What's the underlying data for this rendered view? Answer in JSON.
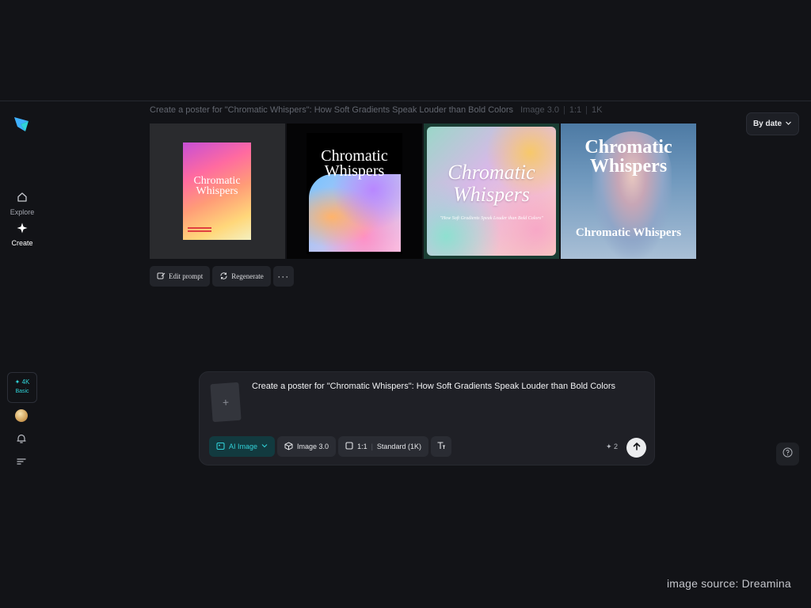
{
  "colors": {
    "background": "#121317",
    "accent": "#31d0d7",
    "surface": "#1f2026"
  },
  "sidebar": {
    "logo_icon": "dreamina-logo-icon",
    "items": [
      {
        "label": "Explore",
        "icon": "home-icon"
      },
      {
        "label": "Create",
        "icon": "sparkle-icon",
        "active": true
      }
    ],
    "credits": {
      "amount": "✦ 4K",
      "tier": "Basic"
    },
    "bottom_icons": [
      "avatar",
      "bell-icon",
      "menu-icon"
    ]
  },
  "generation": {
    "prompt": "Create a poster for \"Chromatic Whispers\": How Soft Gradients Speak Louder than Bold Colors",
    "model": "Image 3.0",
    "ratio": "1:1",
    "resolution": "1K",
    "images": [
      {
        "title_line1": "Chromatic",
        "title_line2": "Whispers"
      },
      {
        "title_line1": "Chromatic",
        "title_line2": "Whispers"
      },
      {
        "title_line1": "Chromatic",
        "title_line2": "Whispers",
        "subtitle": "\"How Soft Gradients Speak Louder than Bold Colors\""
      },
      {
        "title_line1": "Chromatic",
        "title_line2": "Whispers",
        "bottom_title": "Chromatic Whispers"
      }
    ],
    "actions": {
      "edit": "Edit prompt",
      "regenerate": "Regenerate",
      "more": "···"
    }
  },
  "sort": {
    "label": "By date"
  },
  "composer": {
    "prompt": "Create a poster for \"Chromatic Whispers\": How Soft Gradients Speak Louder than Bold Colors",
    "add_symbol": "+",
    "type": "AI Image",
    "model": "Image 3.0",
    "ratio": "1:1",
    "quality": "Standard (1K)",
    "cost": "✦ 2"
  },
  "watermark": "image source: Dreamina"
}
